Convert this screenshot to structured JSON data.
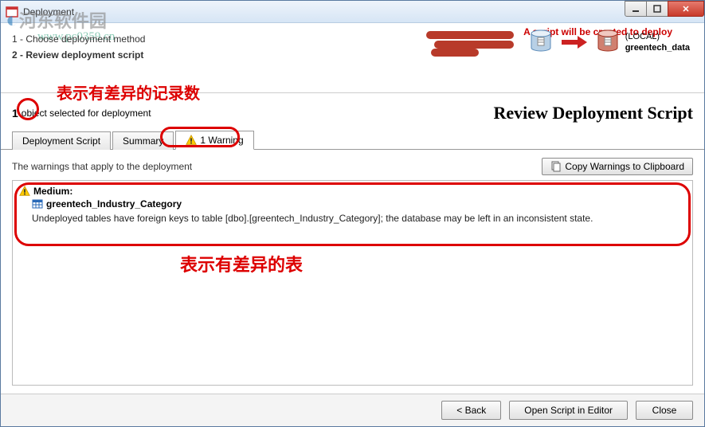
{
  "window": {
    "title": "Deployment"
  },
  "steps": {
    "s1": "1 - Choose deployment method",
    "s2": "2 - Review deployment script"
  },
  "deploy": {
    "notice": "A script will be created to deploy",
    "target_server": "(LOCAL)",
    "target_db": "greentech_data"
  },
  "count": {
    "number": "1",
    "label": "object selected for deployment",
    "annotation": "表示有差异的记录数"
  },
  "heading": "Review Deployment Script",
  "tabs": {
    "script": "Deployment Script",
    "summary": "Summary",
    "warnings": "1 Warning"
  },
  "content": {
    "header": "The warnings that apply to the deployment",
    "copy_btn": "Copy Warnings to Clipboard",
    "level": "Medium:",
    "target": "greentech_Industry_Category",
    "message": "Undeployed tables have foreign keys to table [dbo].[greentech_Industry_Category]; the database may be left in an inconsistent state.",
    "annotation": "表示有差异的表"
  },
  "footer": {
    "back": "< Back",
    "open": "Open Script in Editor",
    "close": "Close"
  },
  "watermark": {
    "brand": "河东软件园",
    "url": "www.pc0359.cn"
  }
}
